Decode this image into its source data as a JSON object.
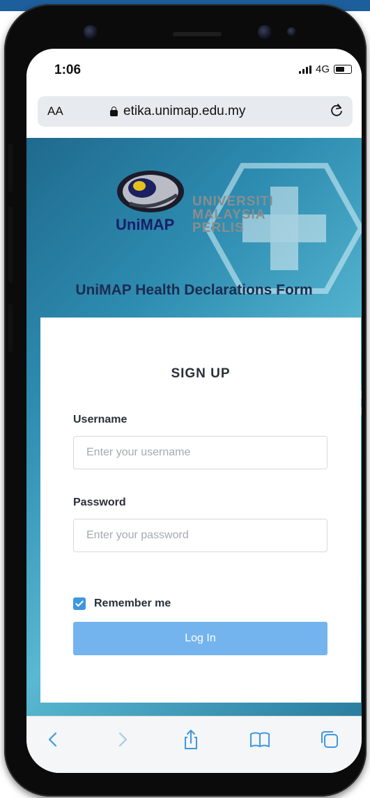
{
  "status_bar": {
    "time": "1:06",
    "network": "4G"
  },
  "browser": {
    "text_size_label": "AA",
    "url": "etika.unimap.edu.my"
  },
  "logo": {
    "lines": [
      "UNIVERSITI",
      "MALAYSIA",
      "PERLIS"
    ],
    "brand": "UniMAP"
  },
  "page": {
    "heading": "UniMAP Health Declarations Form",
    "form_title": "SIGN UP",
    "username_label": "Username",
    "username_placeholder": "Enter your username",
    "password_label": "Password",
    "password_placeholder": "Enter your password",
    "remember_label": "Remember me",
    "remember_checked": true,
    "login_label": "Log In"
  },
  "colors": {
    "accent": "#3f97e0",
    "button": "#73b4ee",
    "heading": "#1d2b4f",
    "top_bar": "#1d5f9c"
  },
  "toolbar_icons": [
    "back-icon",
    "forward-icon",
    "share-icon",
    "bookmarks-icon",
    "tabs-icon"
  ]
}
